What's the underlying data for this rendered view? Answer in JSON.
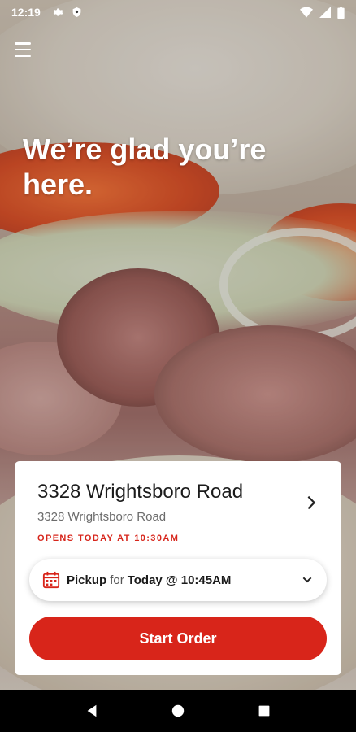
{
  "status_bar": {
    "time": "12:19",
    "left_icons": [
      "gear-icon",
      "shield-icon"
    ],
    "right_icons": [
      "wifi-icon",
      "signal-icon",
      "battery-icon"
    ]
  },
  "hero": {
    "line1": "We’re glad you’re",
    "line2": "here."
  },
  "location_card": {
    "name": "3328 Wrightsboro Road",
    "address": "3328 Wrightsboro Road",
    "hours_status": "OPENS TODAY AT 10:30AM",
    "pickup": {
      "mode": "Pickup",
      "connector": "for",
      "time": "Today @ 10:45AM"
    },
    "start_button": "Start Order"
  },
  "colors": {
    "accent": "#d8251a",
    "card_bg": "#ffffff",
    "status_red": "#d7261c"
  },
  "nav_bar": [
    "back-icon",
    "home-icon",
    "recents-icon"
  ]
}
